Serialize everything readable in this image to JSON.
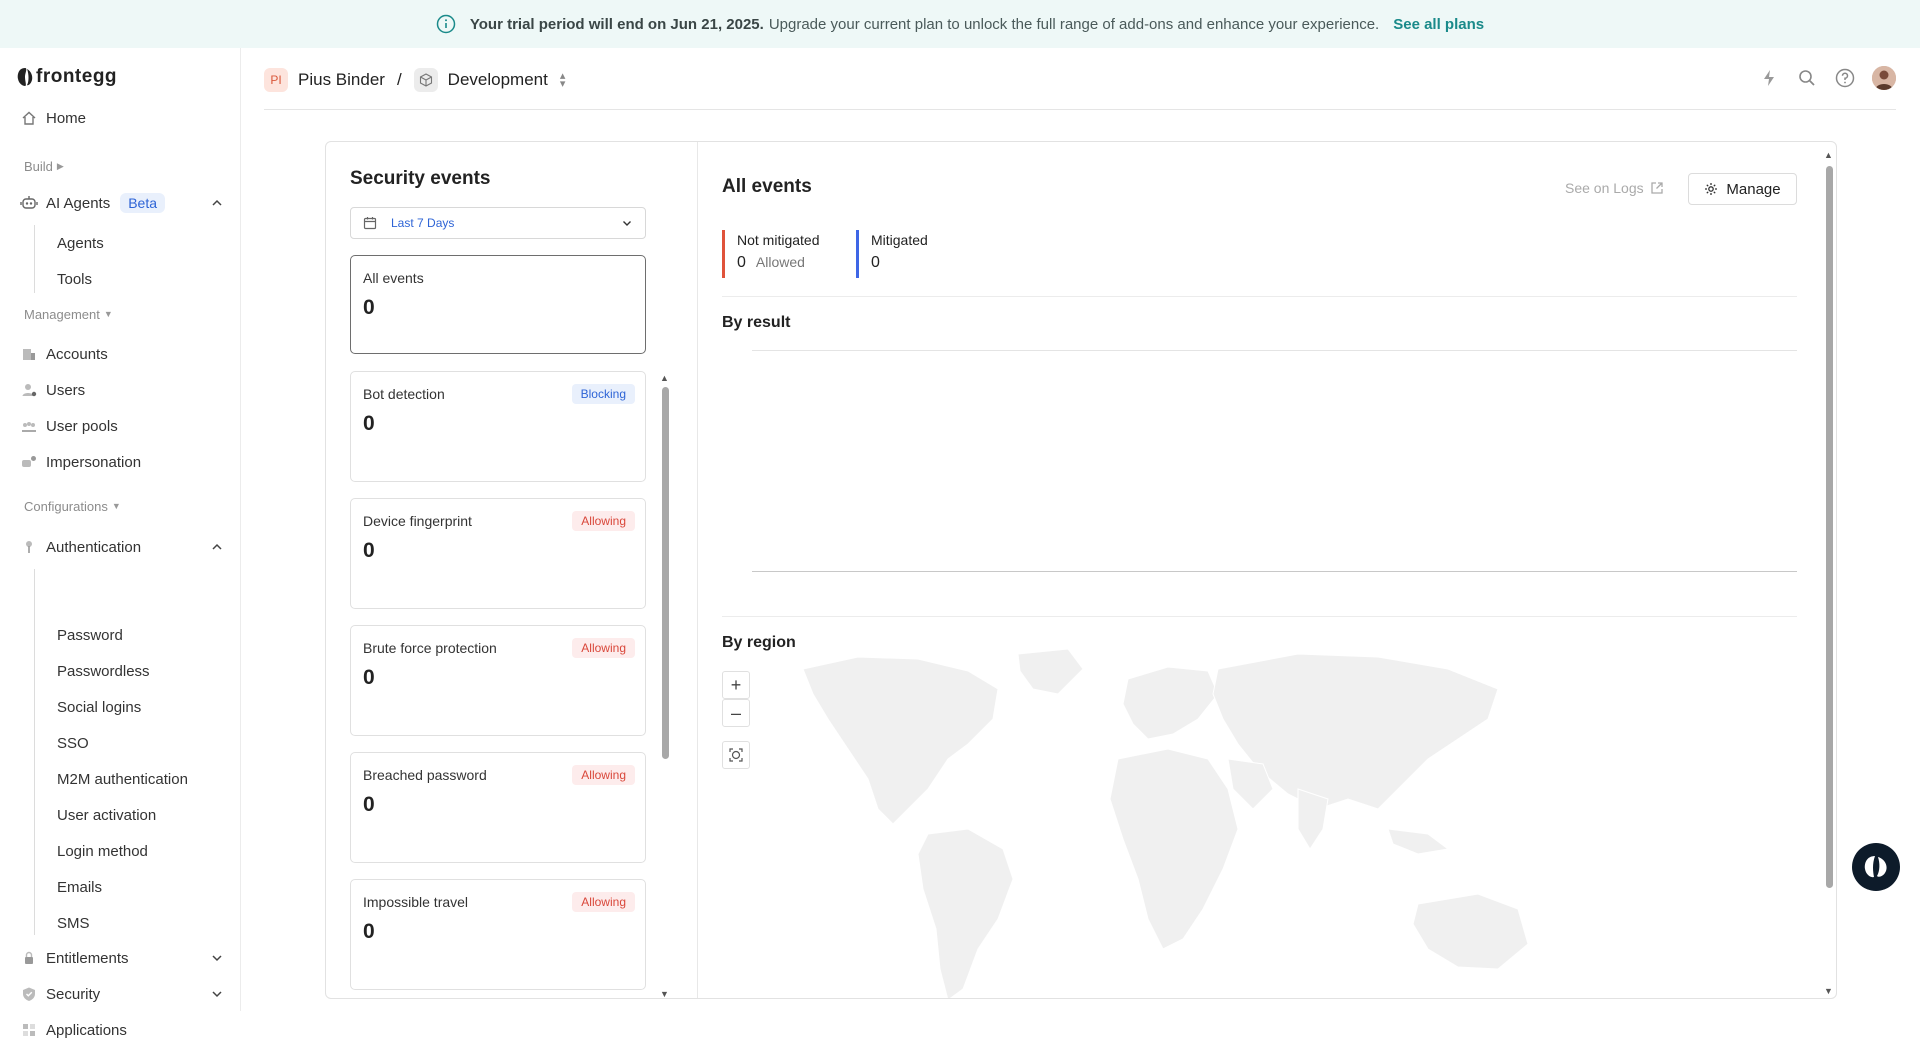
{
  "banner": {
    "bold_text": "Your trial period will end on Jun 21, 2025.",
    "text": "Upgrade your current plan to unlock the full range of add-ons and enhance your experience.",
    "link": "See all plans"
  },
  "sidebar": {
    "logo": "frontegg",
    "home": "Home",
    "build_label": "Build",
    "ai_agents": "AI Agents",
    "beta": "Beta",
    "ai_sub": [
      "Agents",
      "Tools"
    ],
    "management_label": "Management",
    "management_items": [
      "Accounts",
      "Users",
      "User pools",
      "Impersonation"
    ],
    "configurations_label": "Configurations",
    "authentication": "Authentication",
    "auth_sub": [
      "Password",
      "Passwordless",
      "Social logins",
      "SSO",
      "M2M authentication",
      "User activation",
      "Login method",
      "Emails",
      "SMS"
    ],
    "entitlements": "Entitlements",
    "security": "Security",
    "applications": "Applications"
  },
  "header": {
    "workspace_initials": "PI",
    "workspace": "Pius Binder",
    "separator": "/",
    "environment": "Development"
  },
  "security_events": {
    "title": "Security events",
    "date_range": "Last 7 Days",
    "cards": [
      {
        "title": "All events",
        "value": "0",
        "badge": ""
      },
      {
        "title": "Bot detection",
        "value": "0",
        "badge": "Blocking"
      },
      {
        "title": "Device fingerprint",
        "value": "0",
        "badge": "Allowing"
      },
      {
        "title": "Brute force protection",
        "value": "0",
        "badge": "Allowing"
      },
      {
        "title": "Breached password",
        "value": "0",
        "badge": "Allowing"
      },
      {
        "title": "Impossible travel",
        "value": "0",
        "badge": "Allowing"
      }
    ]
  },
  "all_events": {
    "title": "All events",
    "see_on_logs": "See on Logs",
    "manage": "Manage",
    "not_mitigated_label": "Not mitigated",
    "not_mitigated_value": "0",
    "allowed_label": "Allowed",
    "mitigated_label": "Mitigated",
    "mitigated_value": "0",
    "by_result": "By result",
    "by_region": "By region",
    "zoom_in": "+",
    "zoom_out": "–"
  },
  "colors": {
    "accent": "#2e64d6",
    "not_mitigated": "#e0533b",
    "mitigated": "#3e66e6",
    "banner_bg": "#eef8f7",
    "link": "#1a8a8a"
  }
}
